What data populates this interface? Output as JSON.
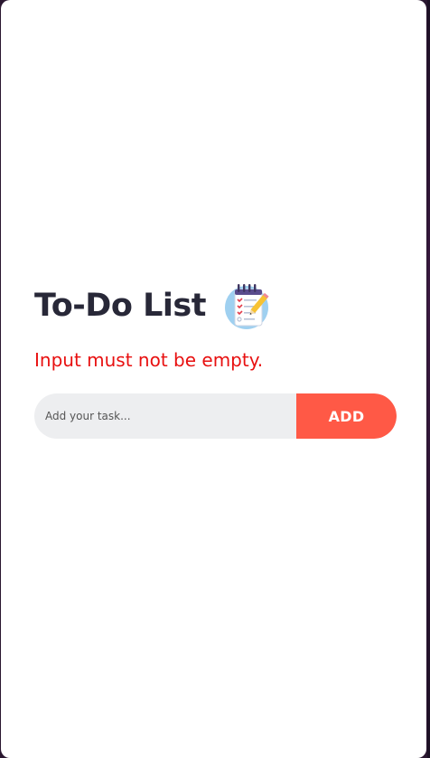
{
  "app": {
    "title": "To-Do List",
    "logo_icon": "notepad-checklist-icon"
  },
  "validation": {
    "error_message": "Input must not be empty."
  },
  "task_form": {
    "input_value": "",
    "placeholder": "Add your task...",
    "add_label": "ADD"
  },
  "colors": {
    "accent": "#ff5946",
    "title": "#282838",
    "error": "#e81010",
    "input_bg": "#edeef0"
  }
}
